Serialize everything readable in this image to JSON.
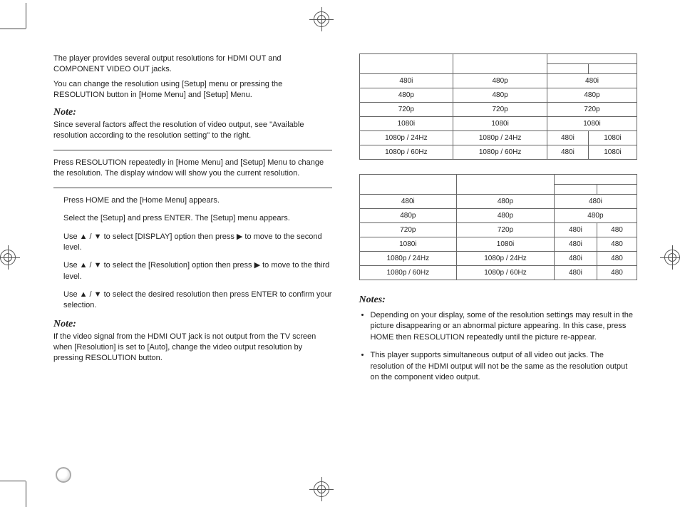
{
  "left": {
    "intro1": "The player provides several output resolutions for HDMI OUT and COMPONENT VIDEO OUT jacks.",
    "intro2": "You can change the resolution using [Setup] menu or pressing the RESOLUTION button in [Home Menu] and [Setup] Menu.",
    "note1_head": "Note:",
    "note1_body": "Since several factors affect the resolution of video output, see \"Available resolution according to the resolution setting\" to the right.",
    "press_res": "Press RESOLUTION repeatedly in [Home Menu] and [Setup] Menu to change the resolution. The display window will show you the current resolution.",
    "steps": [
      "Press HOME and the [Home Menu] appears.",
      "Select the [Setup] and press ENTER. The [Setup] menu appears.",
      "Use ▲ / ▼ to select [DISPLAY] option then press ▶ to move to the second level.",
      "Use ▲ / ▼ to select the [Resolution] option then press ▶ to move to the third level.",
      "Use ▲ / ▼ to select the desired resolution then press ENTER to confirm your selection."
    ],
    "note2_head": "Note:",
    "note2_body": "If the video signal from the HDMI OUT jack is not output from the TV screen when [Resolution] is set to [Auto], change the video output resolution by pressing RESOLUTION button."
  },
  "tables": {
    "t1": {
      "rows": [
        [
          "480i",
          "480p",
          "480i",
          ""
        ],
        [
          "480p",
          "480p",
          "480p",
          ""
        ],
        [
          "720p",
          "720p",
          "720p",
          ""
        ],
        [
          "1080i",
          "1080i",
          "1080i",
          ""
        ],
        [
          "1080p / 24Hz",
          "1080p / 24Hz",
          "480i",
          "1080i"
        ],
        [
          "1080p / 60Hz",
          "1080p / 60Hz",
          "480i",
          "1080i"
        ]
      ]
    },
    "t2": {
      "rows": [
        [
          "480i",
          "480p",
          "480i",
          ""
        ],
        [
          "480p",
          "480p",
          "480p",
          ""
        ],
        [
          "720p",
          "720p",
          "480i",
          "480"
        ],
        [
          "1080i",
          "1080i",
          "480i",
          "480"
        ],
        [
          "1080p / 24Hz",
          "1080p / 24Hz",
          "480i",
          "480"
        ],
        [
          "1080p / 60Hz",
          "1080p / 60Hz",
          "480i",
          "480"
        ]
      ]
    }
  },
  "right": {
    "notes_head": "Notes:",
    "notes": [
      "Depending on your display, some of the resolution settings may result in the picture disappearing or an abnormal picture appearing. In this case, press HOME then RESOLUTION repeatedly until the picture re-appear.",
      "This player supports simultaneous output of all video out jacks. The resolution of the HDMI output will not be the same as the resolution output on the component video output."
    ]
  }
}
